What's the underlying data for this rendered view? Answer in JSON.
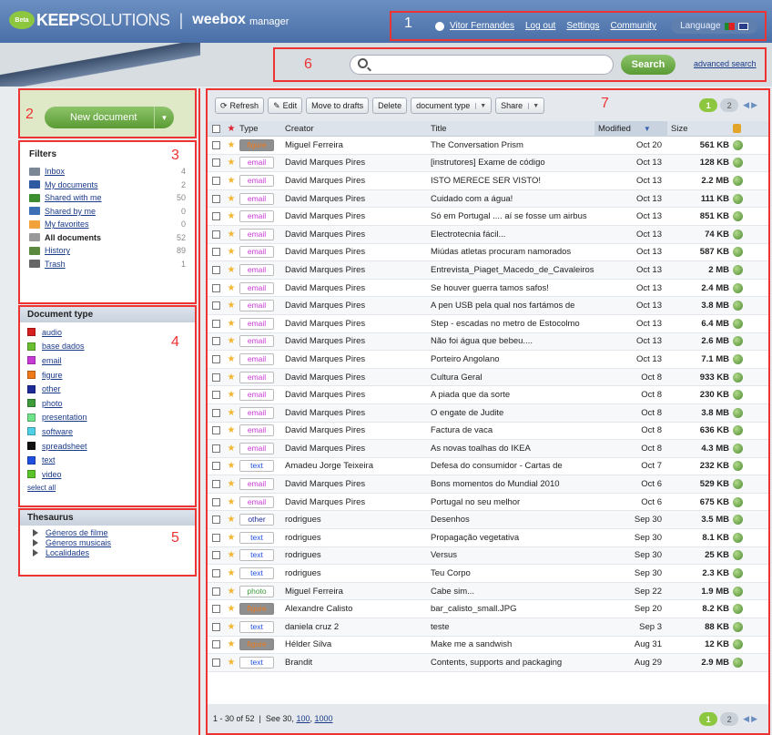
{
  "header": {
    "logo_badge": "Beta",
    "logo_keep": "KEEP",
    "logo_solutions": "SOLUTIONS",
    "app_name": "weebox",
    "app_sub": "manager",
    "user_name": "Vitor Fernandes",
    "logout": "Log out",
    "settings": "Settings",
    "community": "Community",
    "language": "Language"
  },
  "annotations": {
    "n1": "1",
    "n2": "2",
    "n3": "3",
    "n4": "4",
    "n5": "5",
    "n6": "6",
    "n7": "7"
  },
  "search": {
    "placeholder": "",
    "button": "Search",
    "advanced": "advanced search"
  },
  "new_document": {
    "label": "New document",
    "caret": "▼"
  },
  "filters": {
    "title": "Filters",
    "items": [
      {
        "label": "Inbox",
        "count": "4",
        "color": "#7b8794",
        "bold": false
      },
      {
        "label": "My documents",
        "count": "2",
        "color": "#2d5aa0",
        "bold": false
      },
      {
        "label": "Shared with me",
        "count": "50",
        "color": "#3c8d2f",
        "bold": false
      },
      {
        "label": "Shared by me",
        "count": "0",
        "color": "#3b6fb6",
        "bold": false
      },
      {
        "label": "My favorites",
        "count": "0",
        "color": "#f2a23a",
        "bold": false
      },
      {
        "label": "All documents",
        "count": "52",
        "color": "#999999",
        "bold": true
      },
      {
        "label": "History",
        "count": "89",
        "color": "#5b8a3f",
        "bold": false
      },
      {
        "label": "Trash",
        "count": "1",
        "color": "#666666",
        "bold": false
      }
    ]
  },
  "doctypes": {
    "title": "Document type",
    "items": [
      {
        "label": "audio",
        "color": "#d61e1e"
      },
      {
        "label": "base dados",
        "color": "#6abf2f"
      },
      {
        "label": "email",
        "color": "#c83ad6"
      },
      {
        "label": "figure",
        "color": "#f07a1a"
      },
      {
        "label": "other",
        "color": "#1d2b9a"
      },
      {
        "label": "photo",
        "color": "#3d9b3a"
      },
      {
        "label": "presentation",
        "color": "#6fe38a"
      },
      {
        "label": "software",
        "color": "#4fd0e6"
      },
      {
        "label": "spreadsheet",
        "color": "#111111"
      },
      {
        "label": "text",
        "color": "#1e4fe0"
      },
      {
        "label": "video",
        "color": "#5ac42a"
      }
    ],
    "select_all": "select all"
  },
  "thesaurus": {
    "title": "Thesaurus",
    "items": [
      "Géneros de filme",
      "Géneros musicais",
      "Localidades"
    ]
  },
  "toolbar": {
    "refresh": "Refresh",
    "edit": "Edit",
    "move": "Move to drafts",
    "delete": "Delete",
    "doctype": "document type",
    "share": "Share",
    "caret": "▼"
  },
  "pager": {
    "p1": "1",
    "p2": "2"
  },
  "table": {
    "headers": {
      "type": "Type",
      "creator": "Creator",
      "title": "Title",
      "modified": "Modified",
      "size": "Size",
      "sort_arrow": "▼"
    },
    "rows": [
      {
        "type": "figure",
        "creator": "Miguel Ferreira",
        "title": "The Conversation Prism",
        "modified": "Oct 20",
        "size": "561 KB"
      },
      {
        "type": "email",
        "creator": "David Marques Pires",
        "title": "[instrutores] Exame de código",
        "modified": "Oct 13",
        "size": "128 KB"
      },
      {
        "type": "email",
        "creator": "David Marques Pires",
        "title": "ISTO MERECE SER VISTO!",
        "modified": "Oct 13",
        "size": "2.2 MB"
      },
      {
        "type": "email",
        "creator": "David Marques Pires",
        "title": "Cuidado com a água!",
        "modified": "Oct 13",
        "size": "111 KB"
      },
      {
        "type": "email",
        "creator": "David Marques Pires",
        "title": "Só em Portugal .... aí se fosse um airbus",
        "modified": "Oct 13",
        "size": "851 KB"
      },
      {
        "type": "email",
        "creator": "David Marques Pires",
        "title": "Electrotecnia fácil...",
        "modified": "Oct 13",
        "size": "74 KB"
      },
      {
        "type": "email",
        "creator": "David Marques Pires",
        "title": "Miúdas atletas procuram namorados",
        "modified": "Oct 13",
        "size": "587 KB"
      },
      {
        "type": "email",
        "creator": "David Marques Pires",
        "title": "Entrevista_Piaget_Macedo_de_Cavaleiros",
        "modified": "Oct 13",
        "size": "2 MB"
      },
      {
        "type": "email",
        "creator": "David Marques Pires",
        "title": "Se houver guerra tamos safos!",
        "modified": "Oct 13",
        "size": "2.4 MB"
      },
      {
        "type": "email",
        "creator": "David Marques Pires",
        "title": "A pen USB pela qual nos fartámos de",
        "modified": "Oct 13",
        "size": "3.8 MB"
      },
      {
        "type": "email",
        "creator": "David Marques Pires",
        "title": "Step - escadas no metro de Estocolmo",
        "modified": "Oct 13",
        "size": "6.4 MB"
      },
      {
        "type": "email",
        "creator": "David Marques Pires",
        "title": "Não foi água que bebeu....",
        "modified": "Oct 13",
        "size": "2.6 MB"
      },
      {
        "type": "email",
        "creator": "David Marques Pires",
        "title": "Porteiro Angolano",
        "modified": "Oct 13",
        "size": "7.1 MB"
      },
      {
        "type": "email",
        "creator": "David Marques Pires",
        "title": "Cultura Geral",
        "modified": "Oct 8",
        "size": "933 KB"
      },
      {
        "type": "email",
        "creator": "David Marques Pires",
        "title": "A piada que da sorte",
        "modified": "Oct 8",
        "size": "230 KB"
      },
      {
        "type": "email",
        "creator": "David Marques Pires",
        "title": "O engate de Judite",
        "modified": "Oct 8",
        "size": "3.8 MB"
      },
      {
        "type": "email",
        "creator": "David Marques Pires",
        "title": "Factura de vaca",
        "modified": "Oct 8",
        "size": "636 KB"
      },
      {
        "type": "email",
        "creator": "David Marques Pires",
        "title": "As novas toalhas do IKEA",
        "modified": "Oct 8",
        "size": "4.3 MB"
      },
      {
        "type": "text",
        "creator": "Amadeu Jorge Teixeira",
        "title": "Defesa do consumidor - Cartas de",
        "modified": "Oct 7",
        "size": "232 KB"
      },
      {
        "type": "email",
        "creator": "David Marques Pires",
        "title": "Bons momentos do Mundial 2010",
        "modified": "Oct 6",
        "size": "529 KB"
      },
      {
        "type": "email",
        "creator": "David Marques Pires",
        "title": "Portugal no seu melhor",
        "modified": "Oct 6",
        "size": "675 KB"
      },
      {
        "type": "other",
        "creator": "rodrigues",
        "title": "Desenhos",
        "modified": "Sep 30",
        "size": "3.5 MB"
      },
      {
        "type": "text",
        "creator": "rodrigues",
        "title": "Propagação vegetativa",
        "modified": "Sep 30",
        "size": "8.1 KB"
      },
      {
        "type": "text",
        "creator": "rodrigues",
        "title": "Versus",
        "modified": "Sep 30",
        "size": "25 KB"
      },
      {
        "type": "text",
        "creator": "rodrigues",
        "title": "Teu Corpo",
        "modified": "Sep 30",
        "size": "2.3 KB"
      },
      {
        "type": "photo",
        "creator": "Miguel Ferreira",
        "title": "Cabe sim...",
        "modified": "Sep 22",
        "size": "1.9 MB"
      },
      {
        "type": "figure",
        "creator": "Alexandre Calisto",
        "title": "bar_calisto_small.JPG",
        "modified": "Sep 20",
        "size": "8.2 KB"
      },
      {
        "type": "text",
        "creator": "daniela cruz 2",
        "title": "teste",
        "modified": "Sep 3",
        "size": "88 KB"
      },
      {
        "type": "figure",
        "creator": "Hélder Silva",
        "title": "Make me a sandwish",
        "modified": "Aug 31",
        "size": "12 KB"
      },
      {
        "type": "text",
        "creator": "Brandit",
        "title": "Contents, supports and packaging",
        "modified": "Aug 29",
        "size": "2.9 MB"
      }
    ]
  },
  "type_colors": {
    "figure": "#f07a1a",
    "email": "#c83ad6",
    "text": "#1e4fe0",
    "other": "#1d2b9a",
    "photo": "#3d9b3a"
  },
  "footer": {
    "range": "1 - 30 of 52",
    "see": "See 30,",
    "opt100": "100",
    "opt1000": "1000"
  }
}
